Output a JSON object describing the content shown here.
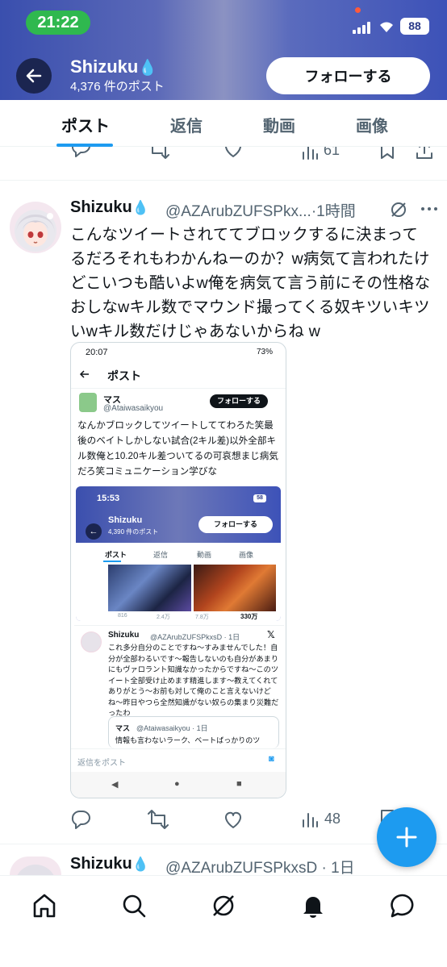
{
  "status_bar": {
    "time": "21:22",
    "battery": "88"
  },
  "profile": {
    "name": "Shizuku",
    "name_emoji": "💧",
    "post_count": "4,376 件のポスト",
    "follow_label": "フォローする"
  },
  "tabs": [
    "ポスト",
    "返信",
    "動画",
    "画像"
  ],
  "prev_tweet": {
    "views": "61"
  },
  "tweet": {
    "name": "Shizuku",
    "handle_time": "@AZArubZUFSPkx...·1時間",
    "text": "こんなツイートされててブロックするに決まってるだろそれもわかんねーのか？w病気て言われたけどこいつも酷いよw俺を病気て言う前にその性格なおしなwキル数でマウンド撮ってくる奴キツいキツいwキル数だけじゃあないからね w",
    "views": "48"
  },
  "screenshot": {
    "status_time": "20:07",
    "battery": "73%",
    "header_title": "ポスト",
    "user_name": "マス",
    "user_handle": "@Ataiwasaikyou",
    "follow_label": "フォローする",
    "text": "なんかブロックしてツイートしててわろた笑最後のベイトしかしない試合(2キル差)以外全部キル数俺と10.20キル差ついてるの可哀想まじ病気だろ笑コミュニケーション学びな",
    "inner": {
      "time": "15:53",
      "battery": "58",
      "name": "Shizuku",
      "post_count": "4,390 件のポスト",
      "follow_label": "フォローする",
      "tabs": [
        "ポスト",
        "返信",
        "動画",
        "画像"
      ],
      "stats": [
        "816",
        "2.4万",
        "7.8万",
        "330万"
      ]
    },
    "quote_name": "Shizuku",
    "quote_handle": "@AZArubZUFSPkxsD · 1日",
    "quote_text": "これ多分自分のことですね〜すみませんでした！自分が全部わるいです〜報告しないのも自分があまりにもヴァロラント知識なかったからですね〜このツイート全部受け止めます精進します〜教えてくれてありがとう〜お前も対して俺のこと言えないけどね〜昨日やつら全然知識がない奴らの集まり災難だったわ",
    "nested_name": "マス",
    "nested_handle": "@Ataiwasaikyou · 1日",
    "nested_text": "情報も言わないラーク、ベートばっかりのツ",
    "reply_placeholder": "返信をポスト"
  },
  "next_tweet": {
    "name": "Shizuku",
    "handle_time": "@AZArubZUFSPkxsD · 1日"
  },
  "colors": {
    "accent": "#1d9bf0",
    "status_green": "#2fb84f"
  }
}
